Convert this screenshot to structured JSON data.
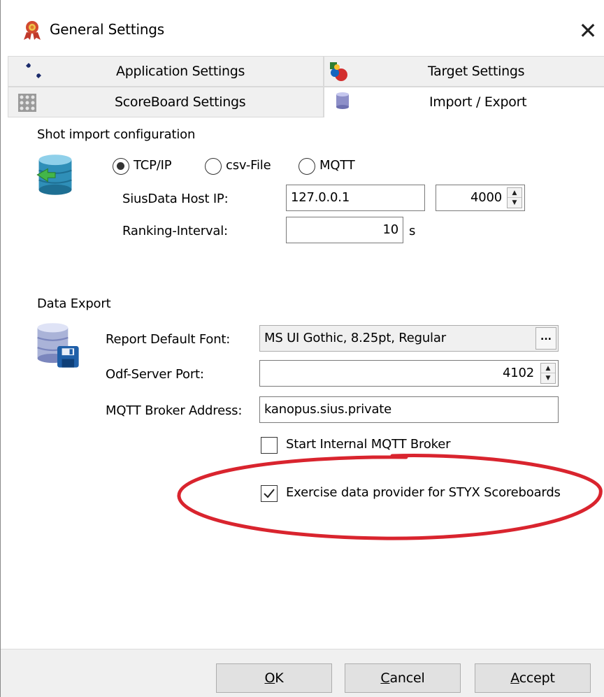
{
  "window": {
    "title": "General Settings",
    "close_glyph": "✕",
    "app_icon": "ribbon-award-icon"
  },
  "tabs": [
    {
      "label": "Application Settings",
      "icon": "wrench-icon",
      "active": false
    },
    {
      "label": "Target Settings",
      "icon": "target-shapes-icon",
      "active": false
    },
    {
      "label": "ScoreBoard Settings",
      "icon": "scoreboard-grid-icon",
      "active": false
    },
    {
      "label": "Import / Export",
      "icon": "database-icon",
      "active": true
    }
  ],
  "shot_import": {
    "title": "Shot import configuration",
    "icon": "database-import-icon",
    "radios": [
      {
        "label": "TCP/IP",
        "checked": true
      },
      {
        "label": "csv-File",
        "checked": false
      },
      {
        "label": "MQTT",
        "checked": false
      }
    ],
    "host_ip_label": "SiusData Host IP:",
    "host_ip_value": "127.0.0.1",
    "port_value": "4000",
    "ranking_label": "Ranking-Interval:",
    "ranking_value": "10",
    "ranking_unit": "s"
  },
  "data_export": {
    "title": "Data Export",
    "icon": "database-save-icon",
    "font_label": "Report Default Font:",
    "font_value": "MS UI Gothic, 8.25pt, Regular",
    "font_button": "...",
    "odf_label": "Odf-Server Port:",
    "odf_value": "4102",
    "mqtt_label": "MQTT Broker Address:",
    "mqtt_value": "kanopus.sius.private",
    "start_broker_label": "Start Internal MQTT Broker",
    "start_broker_checked": false,
    "styx_label": "Exercise data provider for STYX Scoreboards",
    "styx_checked": true
  },
  "footer": {
    "ok": {
      "mnemonic": "O",
      "rest": "K"
    },
    "cancel": {
      "mnemonic": "C",
      "rest": "ancel"
    },
    "accept": {
      "mnemonic": "A",
      "rest": "ccept"
    }
  },
  "colors": {
    "annotation": "#d9242e",
    "window_bg": "#ffffff",
    "tab_bg": "#f0f0f0"
  }
}
